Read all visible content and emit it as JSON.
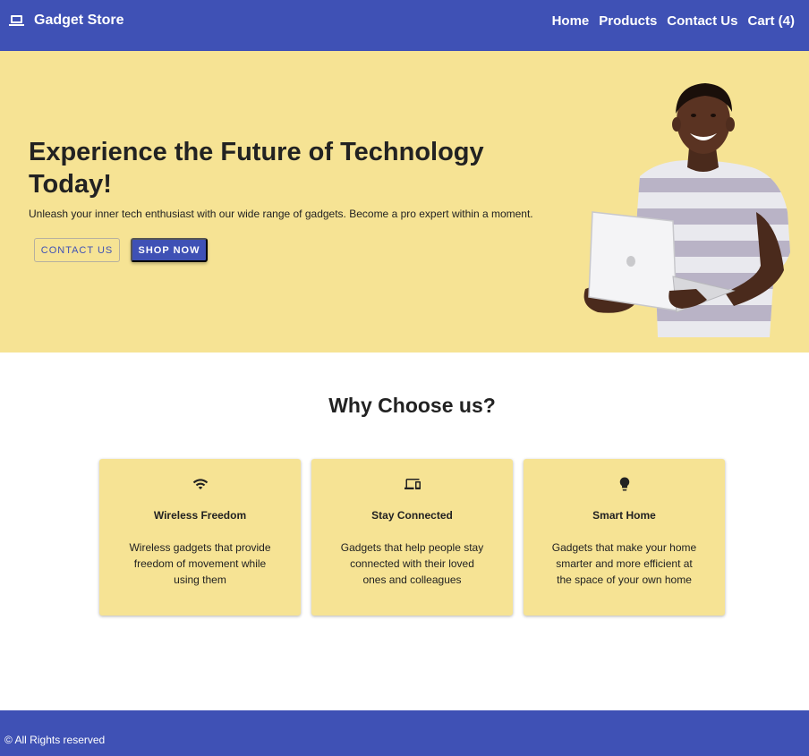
{
  "header": {
    "brand": "Gadget Store",
    "brand_icon": "laptop-icon",
    "nav": [
      {
        "label": "Home"
      },
      {
        "label": "Products"
      },
      {
        "label": "Contact Us"
      },
      {
        "label": "Cart (4)"
      }
    ]
  },
  "hero": {
    "title": "Experience the Future of Technology Today!",
    "subtitle": "Unleash your inner tech enthusiast with our wide range of gadgets. Become a pro expert within a moment.",
    "contact_button": "CONTACT US",
    "shop_button": "SHOP NOW"
  },
  "why": {
    "title": "Why Choose us?",
    "cards": [
      {
        "icon": "wifi-icon",
        "title": "Wireless Freedom",
        "text": "Wireless gadgets that provide freedom of movement while using them"
      },
      {
        "icon": "devices-icon",
        "title": "Stay Connected",
        "text": "Gadgets that help people stay connected with their loved ones and colleagues"
      },
      {
        "icon": "lightbulb-icon",
        "title": "Smart Home",
        "text": "Gadgets that make your home smarter and more efficient at the space of your own home"
      }
    ]
  },
  "footer": {
    "text": "© All Rights reserved"
  },
  "colors": {
    "primary": "#3f51b5",
    "accent": "#f6e394",
    "text": "#222222"
  }
}
